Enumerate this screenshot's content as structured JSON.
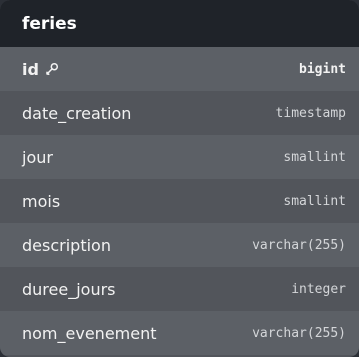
{
  "table": {
    "name": "feries",
    "columns": [
      {
        "name": "id",
        "type": "bigint",
        "primary_key": true,
        "icon": "key-icon"
      },
      {
        "name": "date_creation",
        "type": "timestamp"
      },
      {
        "name": "jour",
        "type": "smallint"
      },
      {
        "name": "mois",
        "type": "smallint"
      },
      {
        "name": "description",
        "type": "varchar(255)"
      },
      {
        "name": "duree_jours",
        "type": "integer"
      },
      {
        "name": "nom_evenement",
        "type": "varchar(255)"
      }
    ]
  },
  "colors": {
    "header_bg": "#1f2329",
    "row_bg": "#52555b",
    "row_alt_bg": "#5c6066"
  }
}
